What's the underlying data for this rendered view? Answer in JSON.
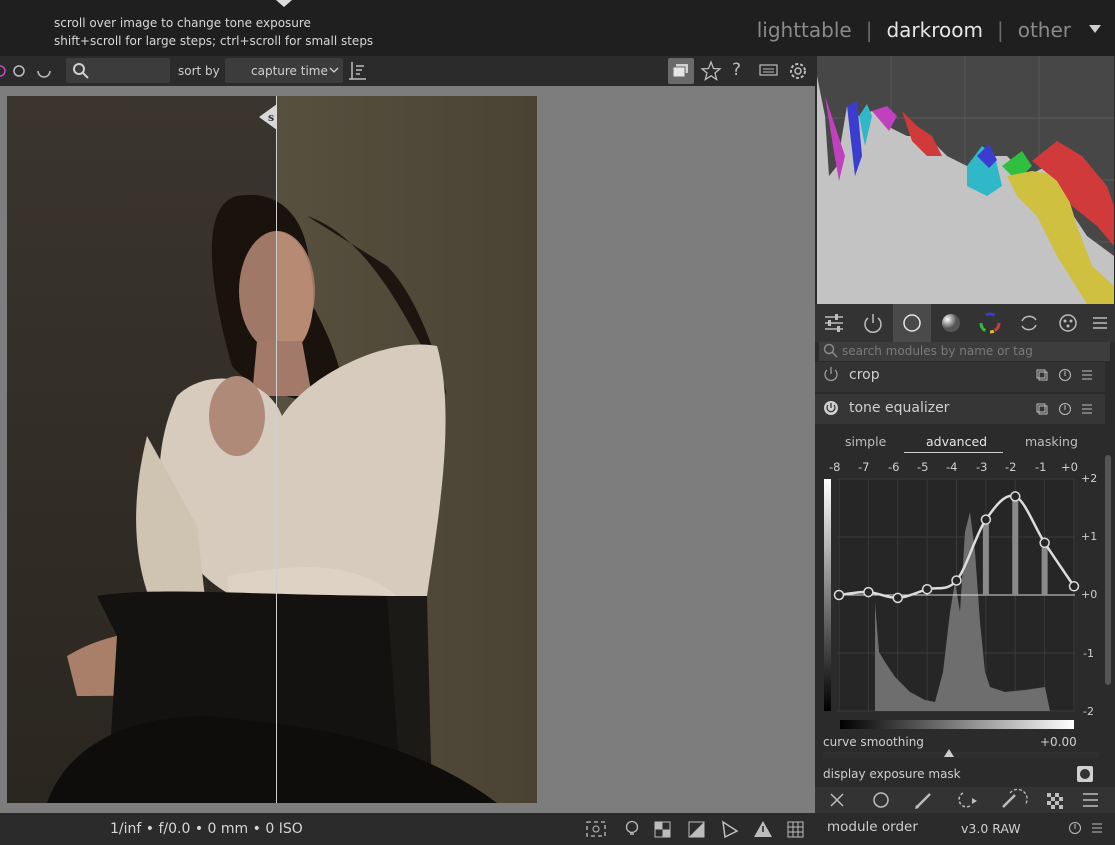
{
  "header": {
    "hint_line1": "scroll over image to change tone exposure",
    "hint_line2": "shift+scroll for large steps; ctrl+scroll for small steps",
    "views": {
      "lighttable": "lighttable",
      "darkroom": "darkroom",
      "other": "other",
      "separator": "|"
    }
  },
  "filmstrip_bar": {
    "sort_label": "sort by",
    "sort_value": "capture time",
    "search_placeholder": ""
  },
  "image_info": {
    "exif": "1/inf • f/0.0 • 0 mm • 0 ISO"
  },
  "modules": {
    "search_placeholder": "search modules by name or tag",
    "crop_title": "crop",
    "tone_eq_title": "tone equalizer"
  },
  "tone_equalizer": {
    "tabs": [
      "simple",
      "advanced",
      "masking"
    ],
    "active_tab": "advanced",
    "ev_labels": [
      "-8",
      "-7",
      "-6",
      "-5",
      "-4",
      "-3",
      "-2",
      "-1",
      "+0"
    ],
    "y_labels": [
      "+2",
      "+1",
      "+0",
      "-1",
      "-2"
    ],
    "curve_points_ev": [
      0.0,
      0.05,
      -0.05,
      0.1,
      0.25,
      1.3,
      1.7,
      0.9,
      0.15
    ],
    "curve_smoothing_label": "curve smoothing",
    "curve_smoothing_value": "+0.00",
    "exposure_mask_label": "display exposure mask"
  },
  "bottom": {
    "module_order_label": "module order",
    "module_order_value": "v3.0 RAW"
  },
  "colors": {
    "accent": "#cfcfcf",
    "panel": "#2b2b2b",
    "center_bg": "#7d7d7d"
  }
}
